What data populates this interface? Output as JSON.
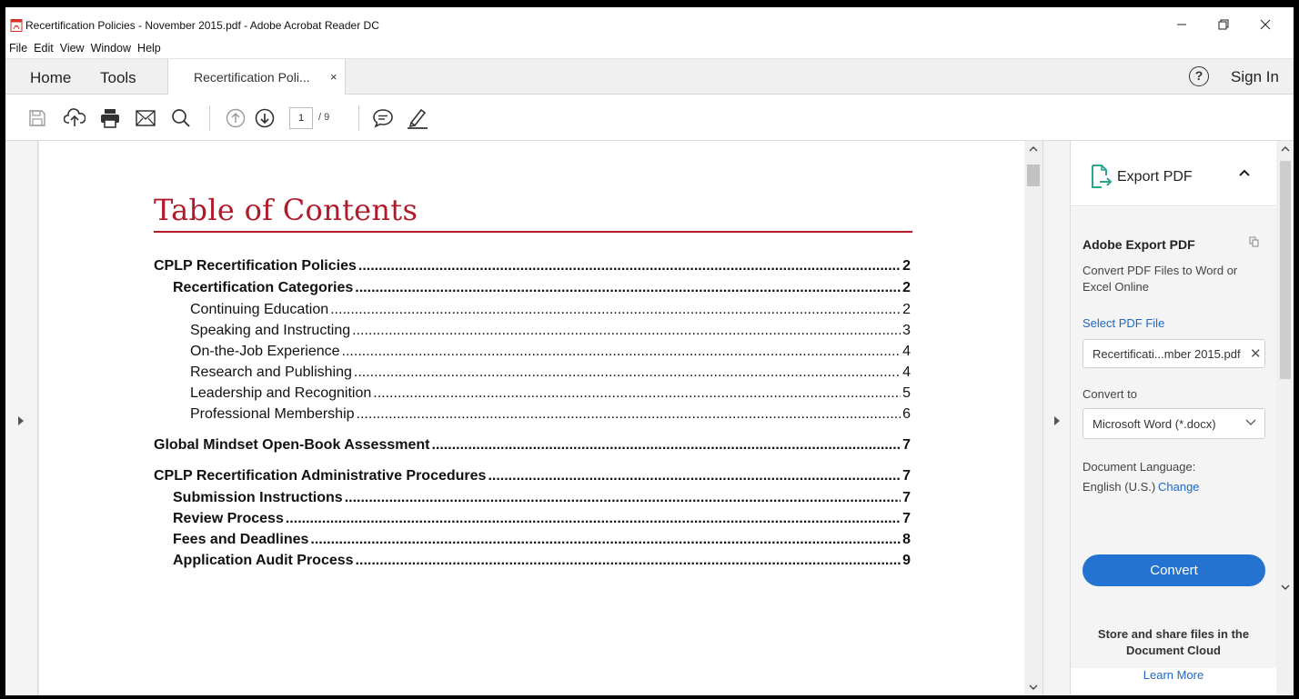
{
  "window": {
    "title": "Recertification Policies - November 2015.pdf - Adobe Acrobat Reader DC",
    "menu": [
      "File",
      "Edit",
      "View",
      "Window",
      "Help"
    ]
  },
  "tabs": {
    "home": "Home",
    "tools": "Tools",
    "doc_tab": "Recertification Poli...",
    "doc_tab_close": "×",
    "help": "?",
    "sign_in": "Sign In"
  },
  "toolbar": {
    "page_current": "1",
    "page_total": "/ 9",
    "icons": [
      "save-icon",
      "upload-icon",
      "print-icon",
      "email-icon",
      "search-icon",
      "page-up-icon",
      "page-down-icon",
      "comment-icon",
      "highlight-pen-icon"
    ]
  },
  "document": {
    "title": "Table of Contents",
    "toc": [
      {
        "label": "CPLP Recertification Policies",
        "page": "2",
        "level": 1
      },
      {
        "label": "Recertification Categories",
        "page": "2",
        "level": 2
      },
      {
        "label": "Continuing Education",
        "page": "2",
        "level": 3
      },
      {
        "label": "Speaking and Instructing",
        "page": "3",
        "level": 3
      },
      {
        "label": "On-the-Job Experience",
        "page": "4",
        "level": 3
      },
      {
        "label": "Research and Publishing",
        "page": "4",
        "level": 3
      },
      {
        "label": "Leadership and Recognition",
        "page": "5",
        "level": 3
      },
      {
        "label": "Professional Membership",
        "page": "6",
        "level": 3
      },
      {
        "label": "Global Mindset Open-Book Assessment",
        "page": "7",
        "level": 1
      },
      {
        "label": "CPLP Recertification Administrative Procedures",
        "page": "7",
        "level": 1
      },
      {
        "label": "Submission Instructions",
        "page": "7",
        "level": 2
      },
      {
        "label": "Review Process",
        "page": "7",
        "level": 2
      },
      {
        "label": "Fees and Deadlines",
        "page": "8",
        "level": 2
      },
      {
        "label": "Application Audit Process",
        "page": "9",
        "level": 2
      }
    ]
  },
  "right_panel": {
    "header": "Export PDF",
    "title": "Adobe Export PDF",
    "description": "Convert PDF Files to Word or Excel Online",
    "select_file_link": "Select PDF File",
    "file_name": "Recertificati...mber 2015.pdf",
    "convert_to_label": "Convert to",
    "convert_to_value": "Microsoft Word (*.docx)",
    "language_label": "Document Language:",
    "language_value": "English (U.S.)",
    "language_change": "Change",
    "convert_button": "Convert",
    "cloud_text": "Store and share files in the Document Cloud",
    "learn_more": "Learn More"
  },
  "colors": {
    "toc_title": "#b21a2a",
    "convert_button": "#2473d1",
    "link": "#2068c8",
    "export_icon": "#2aa58c"
  }
}
